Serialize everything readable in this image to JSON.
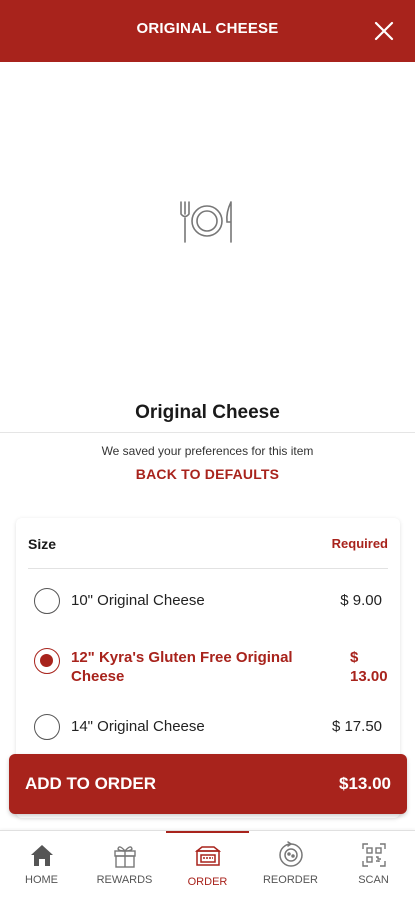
{
  "header": {
    "title": "ORIGINAL CHEESE",
    "close_icon": "close-icon"
  },
  "item": {
    "placeholder_icon": "plate-utensils-icon",
    "title": "Original Cheese"
  },
  "preferences": {
    "message": "We saved your preferences for this item",
    "back_to_defaults": "BACK TO DEFAULTS"
  },
  "options": {
    "group_label": "Size",
    "required_label": "Required",
    "items": [
      {
        "name": "10\" Original Cheese",
        "price": "$ 9.00",
        "selected": false
      },
      {
        "name_line1": "12\" Kyra's Gluten Free Original",
        "name_line2": "Cheese",
        "price_line1": "$",
        "price_line2": "13.00",
        "selected": true
      },
      {
        "name": "14\" Original Cheese",
        "price": "$ 17.50",
        "selected": false
      }
    ]
  },
  "add_to_order": {
    "label": "ADD TO ORDER",
    "price": "$13.00"
  },
  "nav": {
    "items": [
      {
        "label": "HOME",
        "icon": "home-icon",
        "active": false
      },
      {
        "label": "REWARDS",
        "icon": "gift-icon",
        "active": false
      },
      {
        "label": "ORDER",
        "icon": "pizza-box-icon",
        "active": true
      },
      {
        "label": "REORDER",
        "icon": "reorder-icon",
        "active": false
      },
      {
        "label": "SCAN",
        "icon": "qr-scan-icon",
        "active": false
      }
    ]
  },
  "colors": {
    "brand": "#a8231c",
    "text": "#1a1a1a"
  }
}
